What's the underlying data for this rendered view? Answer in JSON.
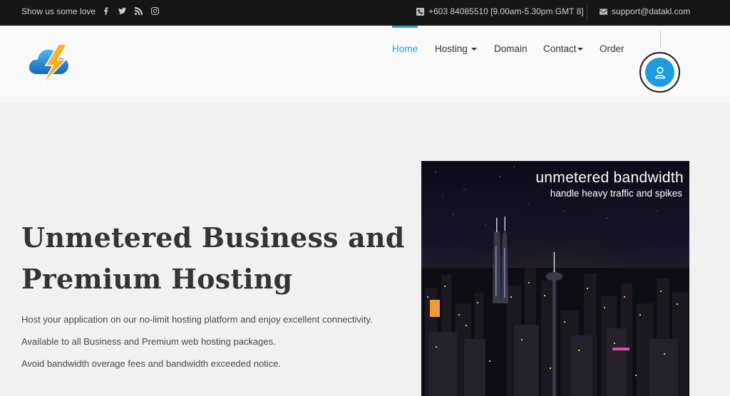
{
  "topbar": {
    "love_text": "Show us some love",
    "social_icons": [
      "facebook-icon",
      "twitter-icon",
      "rss-icon",
      "instagram-icon"
    ],
    "phone": "+603 84085510 [9.00am-5.30pm GMT 8]",
    "email": "support@datakl.com"
  },
  "nav": {
    "items": [
      {
        "label": "Home",
        "active": true
      },
      {
        "label": "Hosting",
        "dropdown": true
      },
      {
        "label": "Domain"
      },
      {
        "label": "Contact",
        "dropdown": true
      },
      {
        "label": "Order"
      }
    ]
  },
  "hero": {
    "title_line1": "Unmetered Business and",
    "title_line2": "Premium Hosting",
    "lines": [
      "Host your application on our no-limit hosting platform and enjoy excellent connectivity.",
      "Available to all Business and Premium web hosting packages.",
      "Avoid bandwidth overage fees and bandwidth exceeded notice."
    ],
    "image_caption1": "unmetered bandwidth",
    "image_caption2": "handle heavy traffic and spikes"
  },
  "colors": {
    "accent": "#2a9fd8",
    "topbar_bg": "#161616",
    "user_button": "#1e9be0"
  }
}
